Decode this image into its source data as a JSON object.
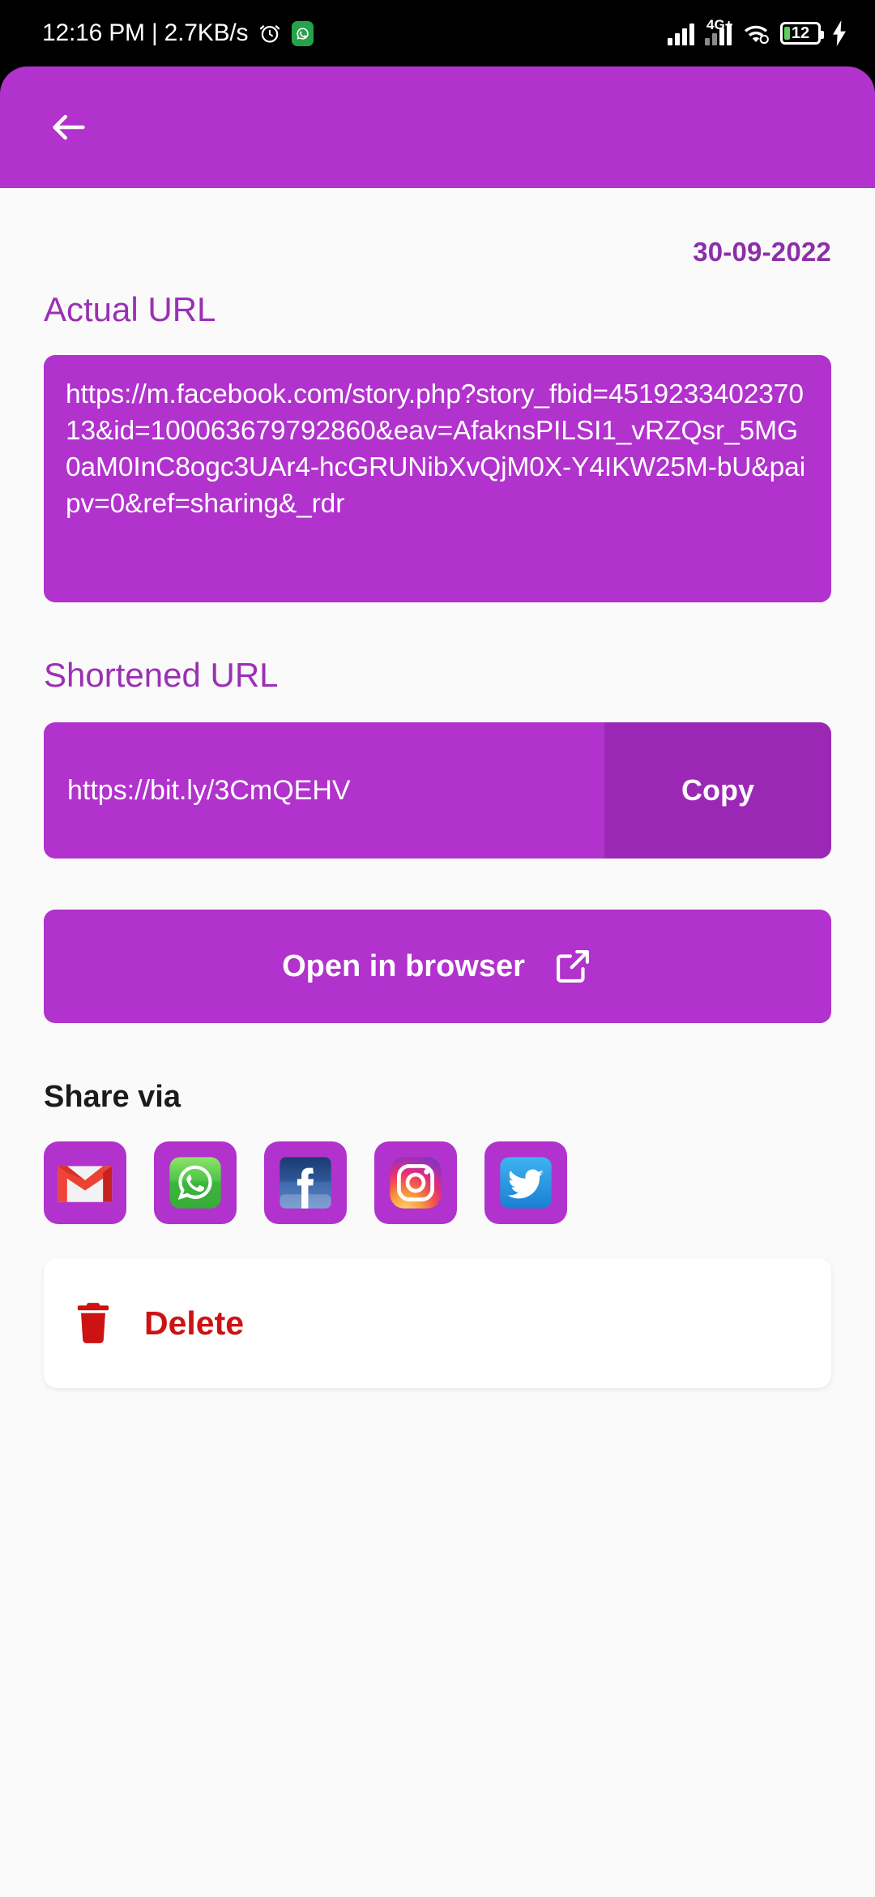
{
  "status_bar": {
    "time_and_speed": "12:16 PM | 2.7KB/s",
    "alarm_icon": "alarm-clock-icon",
    "app_icon": "whatsapp-notification-icon",
    "network_label": "4G+",
    "signal_icon": "signal-bars-icon",
    "wifi_icon": "wifi-icon",
    "battery_level": "12",
    "charging_icon": "charging-bolt-icon"
  },
  "appbar": {
    "back_icon": "back-arrow-icon",
    "background_color": "#b132cc"
  },
  "main": {
    "date": "30-09-2022",
    "actual_url_label": "Actual URL",
    "actual_url": "https://m.facebook.com/story.php?story_fbid=451923340237013&id=100063679792860&eav=AfaknsPILSI1_vRZQsr_5MG0aM0InC8ogc3UAr4-hcGRUNibXvQjM0X-Y4IKW25M-bU&paipv=0&ref=sharing&_rdr",
    "shortened_url_label": "Shortened URL",
    "shortened_url": "https://bit.ly/3CmQEHV",
    "copy_label": "Copy",
    "open_in_browser_label": "Open in browser",
    "open_in_browser_icon": "external-link-icon",
    "share_via_label": "Share via",
    "share_items": [
      {
        "name": "gmail",
        "icon": "gmail-icon"
      },
      {
        "name": "whatsapp",
        "icon": "whatsapp-icon"
      },
      {
        "name": "facebook",
        "icon": "facebook-icon"
      },
      {
        "name": "instagram",
        "icon": "instagram-icon"
      },
      {
        "name": "twitter",
        "icon": "twitter-icon"
      }
    ],
    "delete_label": "Delete",
    "delete_icon": "trash-icon",
    "accent_color": "#b132cc",
    "delete_color": "#cc1212"
  }
}
